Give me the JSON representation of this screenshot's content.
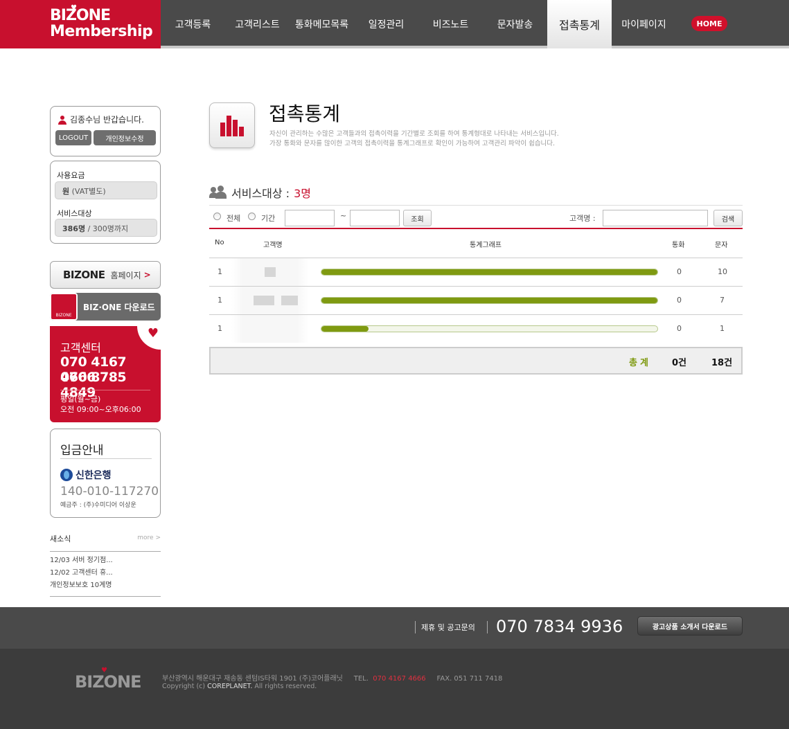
{
  "logo": {
    "line1": "BIZONE",
    "line2": "Membership"
  },
  "nav": {
    "items": [
      {
        "label": "고객등록"
      },
      {
        "label": "고객리스트"
      },
      {
        "label": "통화메모목록"
      },
      {
        "label": "일정관리"
      },
      {
        "label": "비즈노트"
      },
      {
        "label": "문자발송"
      },
      {
        "label": "접촉통계",
        "active": true
      },
      {
        "label": "마이페이지"
      }
    ],
    "home": "HOME"
  },
  "sidebar": {
    "greeting": "김종수님 반갑습니다.",
    "logout": "LOGOUT",
    "edit_profile": "개인정보수정",
    "fee_label": "사용요금",
    "fee_value_strong": "원",
    "fee_value_rest": " (VAT별도)",
    "target_label": "서비스대상",
    "target_value_strong": "386명",
    "target_value_rest": " / 300명까지",
    "biz_logo": "BIZONE",
    "biz_home": "홈페이지",
    "download_icon_text": "BIZONE",
    "download": "BIZ·ONE 다운로드",
    "cs_title": "고객센터",
    "cs_phone1": "070 4167 4666",
    "cs_phone2": "070 8785 4849",
    "cs_days": "평일(월~금)",
    "cs_hours": "오전 09:00~오후06:00",
    "bank_title": "입금안내",
    "bank_name": "신한은행",
    "bank_account": "140-010-117270",
    "bank_owner": "예금주 : (주)수미디어 이상운",
    "news_title": "새소식",
    "news_more": "more >",
    "news_items": [
      "12/03 서버 정기점...",
      "12/02 고객센터 휴...",
      "개인정보보호 10계명"
    ]
  },
  "page": {
    "title": "접촉통계",
    "desc1": "자신이 관리하는  수많은 고객들과의 접촉이력을 기간별로 조회를 하여 통계형대로 나타내는 서비스입니다.",
    "desc2": "가장  통화와 문자를 많이한 고객의 접촉이력을 통계그래프로 확인이 가능하여 고객관리 파악이 쉽습니다.",
    "service_label": "서비스대상 :",
    "service_count": "3명"
  },
  "filter": {
    "all": "전체",
    "period": "기간",
    "tilde": "~",
    "lookup": "조회",
    "customer_label": "고객명 :",
    "search": "검색"
  },
  "table": {
    "headers": {
      "no": "No",
      "name": "고객명",
      "graph": "통계그래프",
      "call": "통화",
      "sms": "문자"
    },
    "rows": [
      {
        "no": "1",
        "call": "0",
        "sms": "10",
        "ratio": 1.0
      },
      {
        "no": "1",
        "call": "0",
        "sms": "7",
        "ratio": 1.0
      },
      {
        "no": "1",
        "call": "0",
        "sms": "1",
        "ratio": 0.14
      }
    ],
    "total_label": "총계",
    "total_call": "0건",
    "total_sms": "18건"
  },
  "footer": {
    "ad_label": "제휴 및 공고문의",
    "ad_phone": "070 7834 9936",
    "ad_download": "광고상품 소개서 다운로드",
    "logo": "BIZONE",
    "address": "부산광역시 해운대구 재송동 센텀IS타워 1901 (주)코어플래닛",
    "tel_label": "TEL.",
    "tel": "070 4167 4666",
    "fax": "FAX.  051 711 7418",
    "copy_prefix": "Copyright (c) ",
    "copy_company": "COREPLANET.",
    "copy_suffix": " All rights reserved."
  },
  "colors": {
    "brand": "#c8102e",
    "bar": "#7f9a11"
  }
}
